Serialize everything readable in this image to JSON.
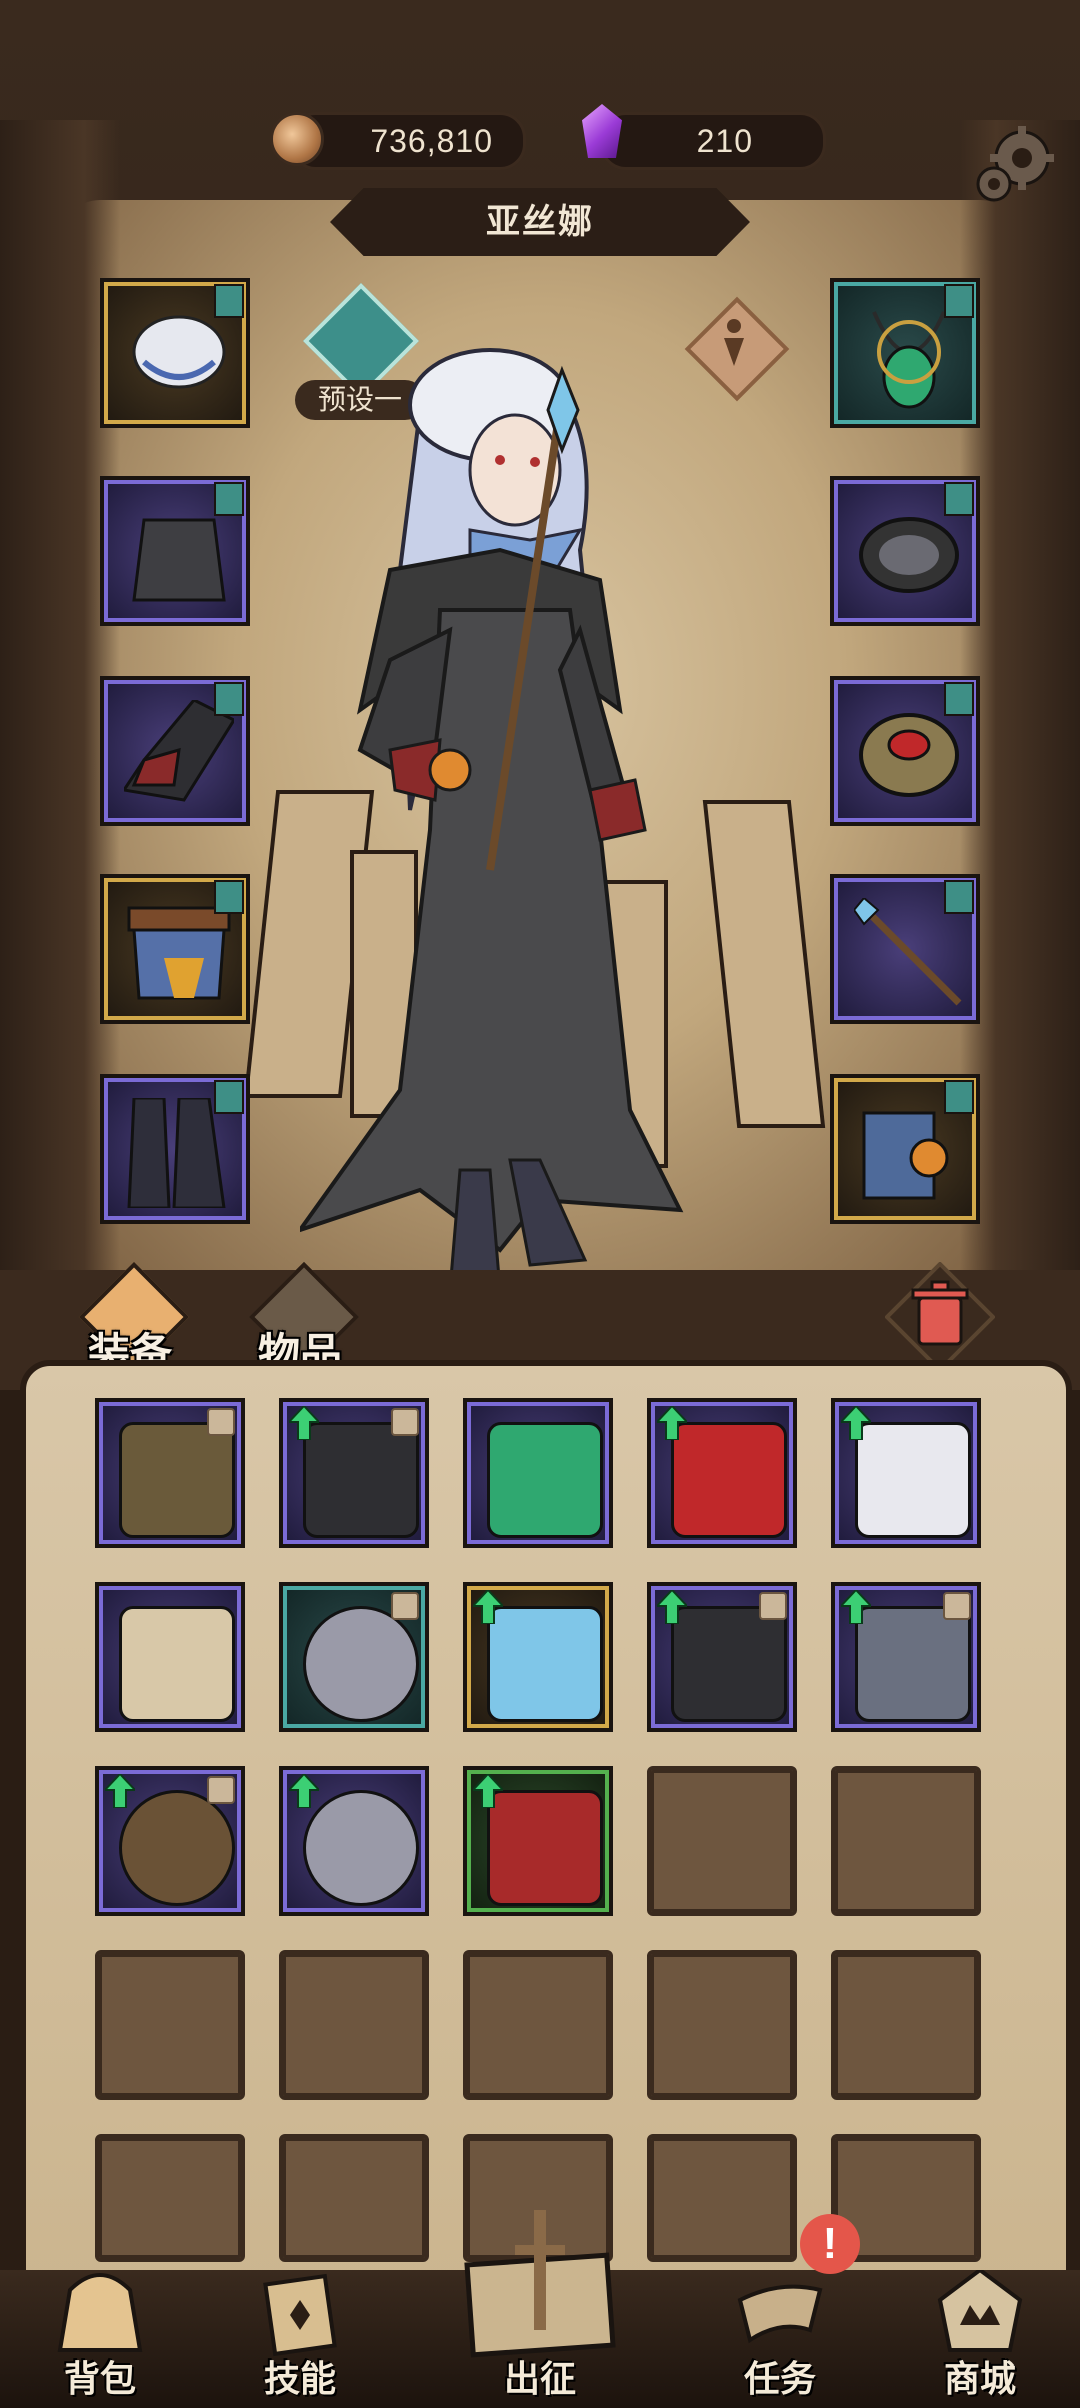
{
  "currency": {
    "coins": "736,810",
    "gems": "210",
    "coin_icon": "copper-coin-icon",
    "gem_icon": "purple-crystal-icon"
  },
  "character": {
    "name": "亚丝娜",
    "preset_label": "预设一"
  },
  "equipment_left": [
    {
      "type": "hat",
      "rarity": "gold",
      "icon": "bonnet-icon"
    },
    {
      "type": "armor",
      "rarity": "purple",
      "icon": "cloak-icon"
    },
    {
      "type": "gloves",
      "rarity": "purple",
      "icon": "glove-icon"
    },
    {
      "type": "belt",
      "rarity": "gold",
      "icon": "skirt-belt-icon"
    },
    {
      "type": "boots",
      "rarity": "purple",
      "icon": "boots-icon"
    }
  ],
  "equipment_right": [
    {
      "type": "necklace",
      "rarity": "teal",
      "icon": "emerald-necklace-icon"
    },
    {
      "type": "ring",
      "rarity": "purple",
      "icon": "dark-ring-icon"
    },
    {
      "type": "ring",
      "rarity": "purple",
      "icon": "ruby-ring-icon"
    },
    {
      "type": "weapon",
      "rarity": "purple",
      "icon": "staff-icon"
    },
    {
      "type": "offhand",
      "rarity": "gold",
      "icon": "spellbook-icon"
    }
  ],
  "tabs": {
    "equip": "装备",
    "items": "物品"
  },
  "inventory": [
    {
      "rarity": "purple",
      "icon": "tome-icon",
      "locked": true,
      "upgrade": false
    },
    {
      "rarity": "purple",
      "icon": "glove-icon",
      "locked": true,
      "upgrade": true
    },
    {
      "rarity": "purple",
      "icon": "emerald-necklace-icon",
      "locked": false,
      "upgrade": false
    },
    {
      "rarity": "purple",
      "icon": "ruby-necklace-icon",
      "locked": false,
      "upgrade": true
    },
    {
      "rarity": "purple",
      "icon": "white-boots-icon",
      "locked": false,
      "upgrade": true
    },
    {
      "rarity": "purple",
      "icon": "scroll-cards-icon",
      "locked": false,
      "upgrade": false
    },
    {
      "rarity": "teal",
      "icon": "star-ring-icon",
      "locked": true,
      "upgrade": false
    },
    {
      "rarity": "gold",
      "icon": "staff-icon",
      "locked": false,
      "upgrade": true
    },
    {
      "rarity": "purple",
      "icon": "glove-icon",
      "locked": true,
      "upgrade": true
    },
    {
      "rarity": "purple",
      "icon": "vest-icon",
      "locked": true,
      "upgrade": true
    },
    {
      "rarity": "purple",
      "icon": "bronze-ring-icon",
      "locked": true,
      "upgrade": true
    },
    {
      "rarity": "purple",
      "icon": "star-ring-icon",
      "locked": false,
      "upgrade": true
    },
    {
      "rarity": "green",
      "icon": "red-robe-icon",
      "locked": false,
      "upgrade": true
    }
  ],
  "inventory_capacity_rows": 5,
  "nav": {
    "bag": "背包",
    "skills": "技能",
    "expedition": "出征",
    "quests": "任务",
    "shop": "商城",
    "quest_alert": "!"
  }
}
